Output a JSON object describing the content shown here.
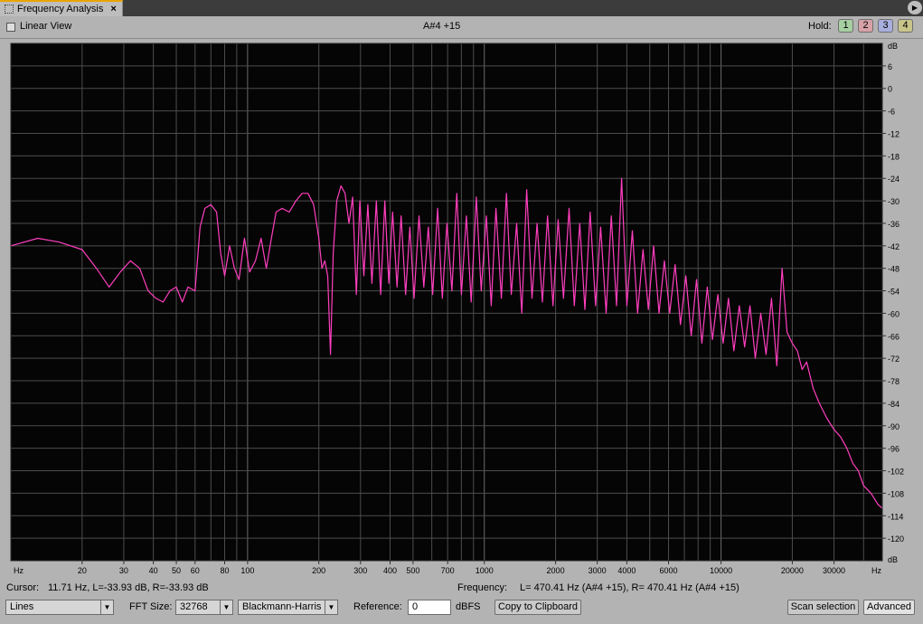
{
  "tab": {
    "title": "Frequency Analysis",
    "close": "×",
    "menu": "▶"
  },
  "toolbar": {
    "linear_view": "Linear View",
    "note": "A#4 +15",
    "hold_label": "Hold:",
    "hold_buttons": [
      "1",
      "2",
      "3",
      "4"
    ]
  },
  "colors": {
    "plot_bg": "#050505",
    "grid": "#4d4d4d",
    "trace": "#ff3fbf"
  },
  "chart_data": {
    "type": "line",
    "xscale": "log",
    "x_ticks": [
      "20",
      "30",
      "40",
      "50",
      "60",
      "80",
      "100",
      "200",
      "300",
      "400",
      "500",
      "700",
      "1000",
      "2000",
      "3000",
      "4000",
      "6000",
      "10000",
      "20000",
      "30000"
    ],
    "x_unit": "Hz",
    "y_ticks": [
      "6",
      "0",
      "-6",
      "-12",
      "-18",
      "-24",
      "-30",
      "-36",
      "-42",
      "-48",
      "-54",
      "-60",
      "-66",
      "-72",
      "-78",
      "-84",
      "-90",
      "-96",
      "-102",
      "-108",
      "-114",
      "-120"
    ],
    "y_unit": "dB",
    "ylim": [
      -126,
      12
    ],
    "xlim": [
      10,
      48000
    ],
    "series": [
      {
        "points": [
          [
            10,
            -42
          ],
          [
            13,
            -40
          ],
          [
            16,
            -41
          ],
          [
            20,
            -43
          ],
          [
            23,
            -48
          ],
          [
            26,
            -53
          ],
          [
            29,
            -49
          ],
          [
            32,
            -46
          ],
          [
            35,
            -48
          ],
          [
            38,
            -54
          ],
          [
            41,
            -56
          ],
          [
            44,
            -57
          ],
          [
            47,
            -54
          ],
          [
            50,
            -53
          ],
          [
            53,
            -57
          ],
          [
            56,
            -53
          ],
          [
            60,
            -54
          ],
          [
            63,
            -37
          ],
          [
            66,
            -32
          ],
          [
            70,
            -31
          ],
          [
            74,
            -33
          ],
          [
            77,
            -44
          ],
          [
            80,
            -50
          ],
          [
            84,
            -42
          ],
          [
            88,
            -48
          ],
          [
            92,
            -51
          ],
          [
            97,
            -40
          ],
          [
            102,
            -49
          ],
          [
            108,
            -46
          ],
          [
            114,
            -40
          ],
          [
            120,
            -48
          ],
          [
            126,
            -40
          ],
          [
            132,
            -33
          ],
          [
            140,
            -32
          ],
          [
            150,
            -33
          ],
          [
            160,
            -30
          ],
          [
            170,
            -28
          ],
          [
            180,
            -28
          ],
          [
            190,
            -31
          ],
          [
            200,
            -40
          ],
          [
            206,
            -48
          ],
          [
            212,
            -46
          ],
          [
            218,
            -50
          ],
          [
            224,
            -71
          ],
          [
            230,
            -44
          ],
          [
            238,
            -30
          ],
          [
            248,
            -26
          ],
          [
            258,
            -28
          ],
          [
            268,
            -36
          ],
          [
            278,
            -29
          ],
          [
            288,
            -55
          ],
          [
            298,
            -30
          ],
          [
            310,
            -50
          ],
          [
            322,
            -31
          ],
          [
            335,
            -52
          ],
          [
            350,
            -30
          ],
          [
            365,
            -55
          ],
          [
            380,
            -30
          ],
          [
            395,
            -52
          ],
          [
            410,
            -33
          ],
          [
            428,
            -53
          ],
          [
            445,
            -34
          ],
          [
            465,
            -55
          ],
          [
            485,
            -37
          ],
          [
            505,
            -56
          ],
          [
            530,
            -34
          ],
          [
            555,
            -53
          ],
          [
            580,
            -37
          ],
          [
            605,
            -55
          ],
          [
            635,
            -32
          ],
          [
            665,
            -56
          ],
          [
            695,
            -36
          ],
          [
            730,
            -54
          ],
          [
            765,
            -28
          ],
          [
            800,
            -55
          ],
          [
            840,
            -34
          ],
          [
            880,
            -57
          ],
          [
            925,
            -29
          ],
          [
            970,
            -54
          ],
          [
            1020,
            -34
          ],
          [
            1070,
            -58
          ],
          [
            1120,
            -32
          ],
          [
            1180,
            -56
          ],
          [
            1240,
            -28
          ],
          [
            1300,
            -55
          ],
          [
            1370,
            -36
          ],
          [
            1440,
            -60
          ],
          [
            1510,
            -27
          ],
          [
            1590,
            -56
          ],
          [
            1670,
            -36
          ],
          [
            1760,
            -57
          ],
          [
            1850,
            -34
          ],
          [
            1950,
            -58
          ],
          [
            2050,
            -35
          ],
          [
            2160,
            -56
          ],
          [
            2280,
            -32
          ],
          [
            2400,
            -58
          ],
          [
            2530,
            -36
          ],
          [
            2660,
            -59
          ],
          [
            2800,
            -33
          ],
          [
            2950,
            -58
          ],
          [
            3100,
            -37
          ],
          [
            3270,
            -60
          ],
          [
            3440,
            -34
          ],
          [
            3620,
            -58
          ],
          [
            3800,
            -24
          ],
          [
            4000,
            -58
          ],
          [
            4220,
            -38
          ],
          [
            4440,
            -60
          ],
          [
            4680,
            -43
          ],
          [
            4930,
            -59
          ],
          [
            5190,
            -42
          ],
          [
            5470,
            -60
          ],
          [
            5760,
            -46
          ],
          [
            6070,
            -60
          ],
          [
            6400,
            -47
          ],
          [
            6740,
            -63
          ],
          [
            7100,
            -50
          ],
          [
            7480,
            -66
          ],
          [
            7880,
            -51
          ],
          [
            8300,
            -68
          ],
          [
            8750,
            -53
          ],
          [
            9200,
            -67
          ],
          [
            9700,
            -55
          ],
          [
            10200,
            -68
          ],
          [
            10750,
            -56
          ],
          [
            11330,
            -70
          ],
          [
            11940,
            -58
          ],
          [
            12580,
            -69
          ],
          [
            13250,
            -58
          ],
          [
            13960,
            -72
          ],
          [
            14710,
            -60
          ],
          [
            15500,
            -71
          ],
          [
            16330,
            -56
          ],
          [
            17200,
            -74
          ],
          [
            18100,
            -48
          ],
          [
            19000,
            -65
          ],
          [
            20000,
            -68
          ],
          [
            21000,
            -70
          ],
          [
            22000,
            -75
          ],
          [
            23000,
            -73
          ],
          [
            24500,
            -80
          ],
          [
            26000,
            -84
          ],
          [
            28000,
            -88
          ],
          [
            30000,
            -91
          ],
          [
            32000,
            -93
          ],
          [
            34000,
            -96
          ],
          [
            36000,
            -100
          ],
          [
            38000,
            -102
          ],
          [
            40000,
            -106
          ],
          [
            43000,
            -108
          ],
          [
            46000,
            -111
          ],
          [
            48000,
            -112
          ]
        ]
      }
    ]
  },
  "status": {
    "cursor_label": "Cursor:",
    "cursor_value": "11.71 Hz, L=-33.93 dB, R=-33.93 dB",
    "frequency_label": "Frequency:",
    "frequency_value": "L= 470.41 Hz (A#4 +15), R= 470.41 Hz (A#4 +15)"
  },
  "controls": {
    "plot_type": "Lines",
    "fft_label": "FFT Size:",
    "fft_size": "32768",
    "window": "Blackmann-Harris",
    "reference_label": "Reference:",
    "reference_value": "0",
    "reference_unit": "dBFS",
    "copy_button": "Copy to Clipboard",
    "scan_button": "Scan selection",
    "advanced_button": "Advanced"
  }
}
